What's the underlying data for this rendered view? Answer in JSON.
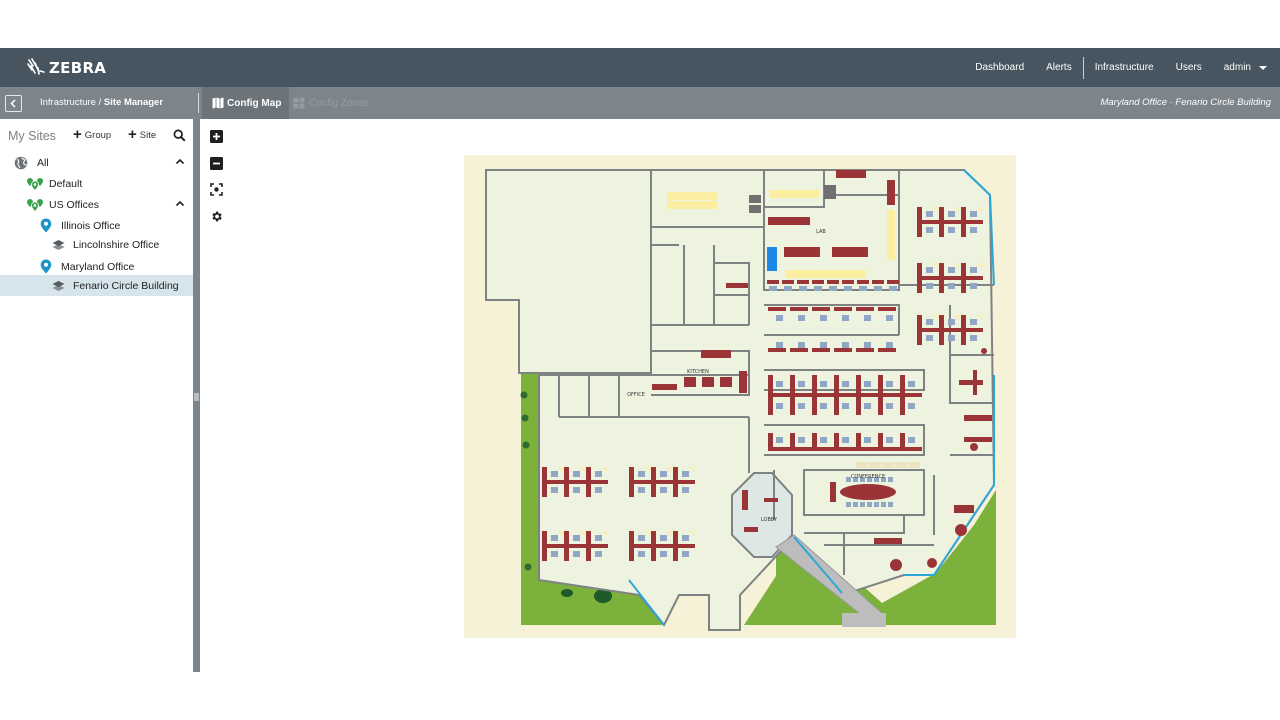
{
  "brand": {
    "name": "ZEBRA"
  },
  "topnav": {
    "items": [
      {
        "label": "Dashboard"
      },
      {
        "label": "Alerts"
      },
      {
        "label": "Infrastructure"
      },
      {
        "label": "Users"
      }
    ],
    "user": "admin"
  },
  "subbar": {
    "breadcrumb_parent": "Infrastructure",
    "breadcrumb_sep": " / ",
    "breadcrumb_current": "Site Manager",
    "tabs": [
      {
        "label": "Config Map",
        "active": true
      },
      {
        "label": "Config Zones",
        "active": false
      }
    ],
    "location": "Maryland Office · Fenario Circle Building"
  },
  "sidebar": {
    "title": "My Sites",
    "add_group_label": "Group",
    "add_site_label": "Site",
    "tree": [
      {
        "label": "All",
        "type": "globe",
        "level": 0,
        "expanded": true
      },
      {
        "label": "Default",
        "type": "group",
        "level": 1
      },
      {
        "label": "US Offices",
        "type": "group",
        "level": 1,
        "expanded": true
      },
      {
        "label": "Illinois Office",
        "type": "site",
        "level": 2
      },
      {
        "label": "Lincolnshire Office",
        "type": "building",
        "level": 3
      },
      {
        "label": "Maryland Office",
        "type": "site",
        "level": 2
      },
      {
        "label": "Fenario Circle Building",
        "type": "building",
        "level": 3,
        "selected": true
      }
    ]
  },
  "map_tools": [
    {
      "name": "zoom-in",
      "icon": "plus-square-icon"
    },
    {
      "name": "zoom-out",
      "icon": "minus-square-icon"
    },
    {
      "name": "fit-to-screen",
      "icon": "focus-icon"
    },
    {
      "name": "settings",
      "icon": "gear-icon"
    }
  ],
  "floorplan": {
    "room_labels": {
      "lab": "LAB",
      "kitchen": "KITCHEN",
      "office": "OFFICE",
      "conference": "CONFERENCE",
      "lobby": "LOBBY"
    }
  },
  "colors": {
    "topbar": "#46555f",
    "subbar": "#7d858b",
    "selected_row": "#d6e4ec",
    "group_icon": "#3aa14a",
    "site_icon": "#1e93c6",
    "floor": "#eef3e0",
    "site_bg": "#f5f2d8",
    "grass": "#7cb23c",
    "desk": "#9b3436",
    "chair": "#8fa7c4",
    "wall": "#7f8283"
  }
}
